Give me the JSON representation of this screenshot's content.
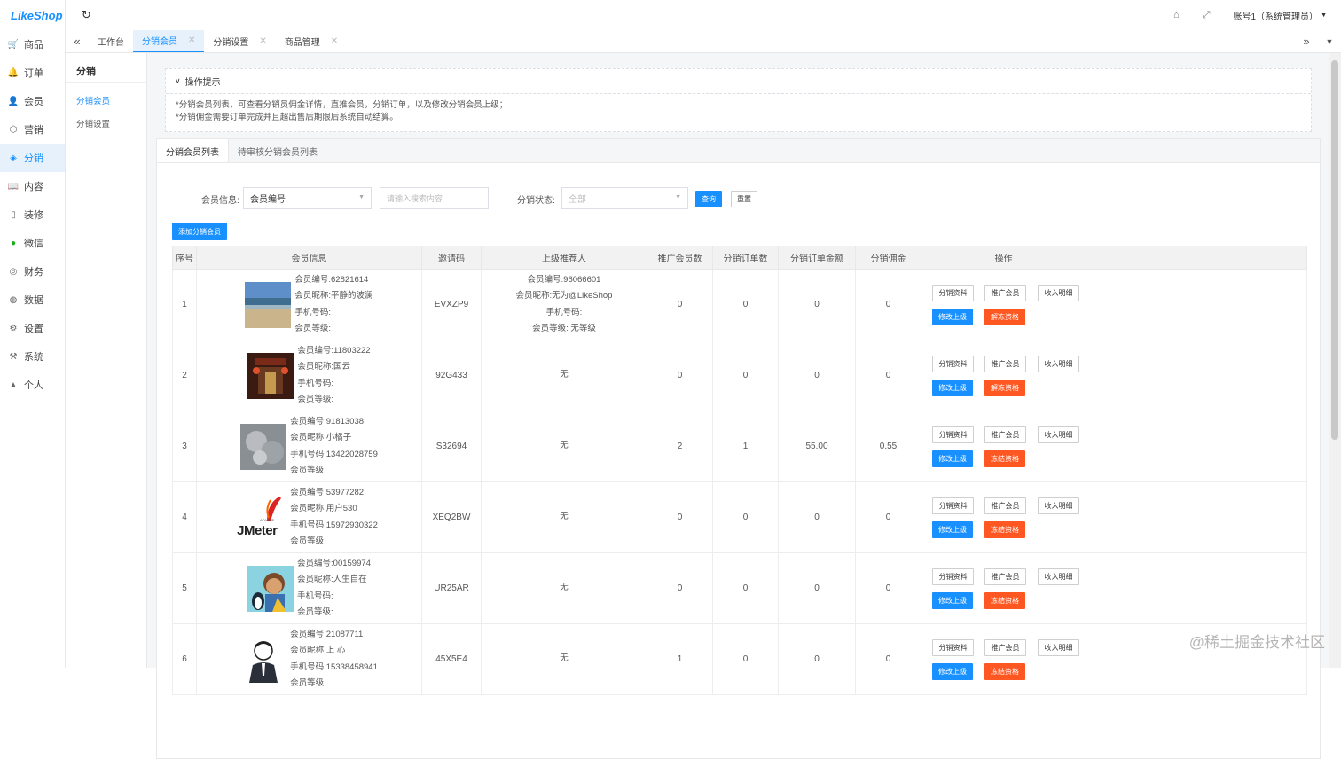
{
  "app": {
    "logo": "LikeShop"
  },
  "sidebar": {
    "items": [
      {
        "label": "商品",
        "icon": "cart-icon",
        "glyph": "🛒"
      },
      {
        "label": "订单",
        "icon": "bell-icon",
        "glyph": "🔔"
      },
      {
        "label": "会员",
        "icon": "user-icon",
        "glyph": "👤"
      },
      {
        "label": "营销",
        "icon": "box-icon",
        "glyph": "⬡"
      },
      {
        "label": "分销",
        "icon": "layers-icon",
        "glyph": "◈",
        "active": true
      },
      {
        "label": "内容",
        "icon": "book-icon",
        "glyph": "📖"
      },
      {
        "label": "装修",
        "icon": "phone-icon",
        "glyph": "▯"
      },
      {
        "label": "微信",
        "icon": "wechat-icon",
        "glyph": "●"
      },
      {
        "label": "财务",
        "icon": "finance-icon",
        "glyph": "◎"
      },
      {
        "label": "数据",
        "icon": "chart-icon",
        "glyph": "◍"
      },
      {
        "label": "设置",
        "icon": "settings-icon",
        "glyph": "⚙"
      },
      {
        "label": "系统",
        "icon": "system-icon",
        "glyph": "⚒"
      },
      {
        "label": "个人",
        "icon": "person-icon",
        "glyph": "▲"
      }
    ]
  },
  "topbar": {
    "account": "账号1（系统管理员）"
  },
  "tabs": [
    {
      "label": "工作台",
      "closable": false
    },
    {
      "label": "分销会员",
      "closable": true,
      "active": true
    },
    {
      "label": "分销设置",
      "closable": true
    },
    {
      "label": "商品管理",
      "closable": true
    }
  ],
  "subnav": {
    "title": "分销",
    "items": [
      {
        "label": "分销会员",
        "active": true
      },
      {
        "label": "分销设置"
      }
    ]
  },
  "tips": {
    "title": "操作提示",
    "lines": [
      "*分销会员列表，可查看分销员佣金详情，直推会员，分销订单，以及修改分销会员上级；",
      "*分销佣金需要订单完成并且超出售后期限后系统自动结算。"
    ]
  },
  "card_tabs": [
    "分销会员列表",
    "待审核分销会员列表"
  ],
  "filter": {
    "member_info_label": "会员信息:",
    "member_info_select": "会员编号",
    "search_placeholder": "请输入搜索内容",
    "status_label": "分销状态:",
    "status_select": "全部",
    "query_button": "查询",
    "reset_button": "重置"
  },
  "add_button": "添加分销会员",
  "table": {
    "headers": [
      "序号",
      "会员信息",
      "邀请码",
      "上级推荐人",
      "推广会员数",
      "分销订单数",
      "分销订单金额",
      "分销佣金",
      "操作"
    ],
    "rows": [
      {
        "no": "1",
        "avatar": "beach",
        "code": "会员编号:62821614",
        "nick": "会员昵称:平静的波澜",
        "phone": "手机号码:",
        "level": "会员等级:",
        "invite": "EVXZP9",
        "ref": [
          "会员编号:96066601",
          "会员昵称:无为@LikeShop",
          "手机号码:",
          "会员等级: 无等级"
        ],
        "promoted": "0",
        "orders": "0",
        "amount": "0",
        "commission": "0",
        "op_btn": "解冻资格"
      },
      {
        "no": "2",
        "avatar": "temple",
        "code": "会员编号:11803222",
        "nick": "会员昵称:国云",
        "phone": "手机号码:",
        "level": "会员等级:",
        "invite": "92G433",
        "ref": [
          "无"
        ],
        "promoted": "0",
        "orders": "0",
        "amount": "0",
        "commission": "0",
        "op_btn": "解冻资格"
      },
      {
        "no": "3",
        "avatar": "pastry",
        "code": "会员编号:91813038",
        "nick": "会员昵称:小橘子",
        "phone": "手机号码:13422028759",
        "level": "会员等级:",
        "invite": "S32694",
        "ref": [
          "无"
        ],
        "promoted": "2",
        "orders": "1",
        "amount": "55.00",
        "commission": "0.55",
        "op_btn": "冻结资格"
      },
      {
        "no": "4",
        "avatar": "jmeter",
        "code": "会员编号:53977282",
        "nick": "会员昵称:用户530",
        "phone": "手机号码:15972930322",
        "level": "会员等级:",
        "invite": "XEQ2BW",
        "ref": [
          "无"
        ],
        "promoted": "0",
        "orders": "0",
        "amount": "0",
        "commission": "0",
        "op_btn": "冻结资格"
      },
      {
        "no": "5",
        "avatar": "cartoon",
        "code": "会员编号:00159974",
        "nick": "会员昵称:人生自在",
        "phone": "手机号码:",
        "level": "会员等级:",
        "invite": "UR25AR",
        "ref": [
          "无"
        ],
        "promoted": "0",
        "orders": "0",
        "amount": "0",
        "commission": "0",
        "op_btn": "冻结资格"
      },
      {
        "no": "6",
        "avatar": "suit",
        "code": "会员编号:21087711",
        "nick": "会员昵称:上 心",
        "phone": "手机号码:15338458941",
        "level": "会员等级:",
        "invite": "45X5E4",
        "ref": [
          "无"
        ],
        "promoted": "1",
        "orders": "0",
        "amount": "0",
        "commission": "0",
        "op_btn": "冻结资格"
      }
    ],
    "op_labels": {
      "profile": "分销资料",
      "promote": "推广会员",
      "income": "收入明细",
      "edit_parent": "修改上级"
    }
  },
  "avatar_text": {
    "jmeter_small": "APACHE",
    "jmeter_big": "JMeter"
  },
  "watermark": "@稀土掘金技术社区",
  "colors": {
    "primary": "#1890ff",
    "danger": "#ff5722"
  }
}
